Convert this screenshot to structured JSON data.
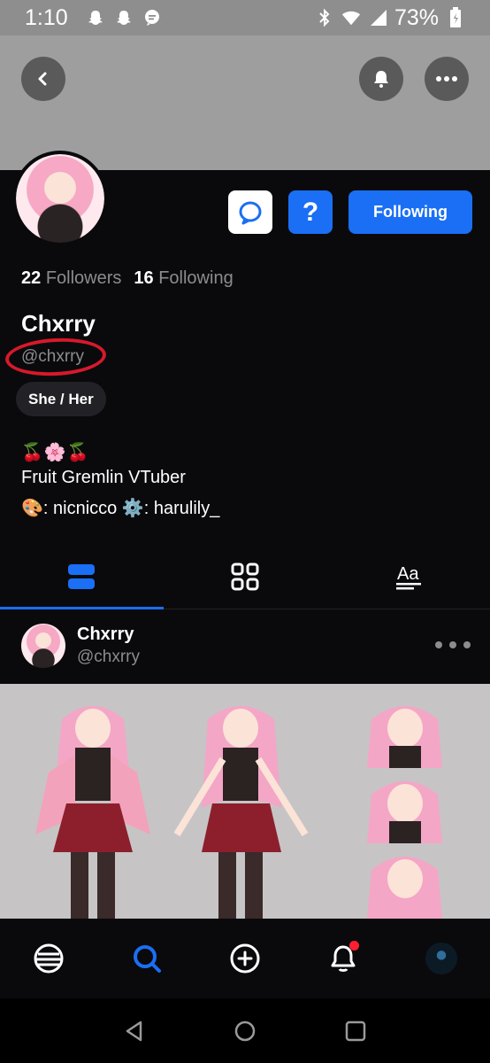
{
  "status_bar": {
    "time": "1:10",
    "battery": "73%"
  },
  "profile": {
    "follow_button": "Following",
    "ask_button": "?",
    "followers_count": "22",
    "followers_label": "Followers",
    "following_count": "16",
    "following_label": "Following",
    "display_name": "Chxrry",
    "handle": "@chxrry",
    "pronouns": "She / Her",
    "bio_emoji": "🍒🌸🍒",
    "bio_line1": "Fruit Gremlin VTuber",
    "bio_line2": "🎨: nicnicco ⚙️: harulily_"
  },
  "tabs": {
    "active_index": 0,
    "items": [
      "posts-icon",
      "grid-icon",
      "text-icon"
    ]
  },
  "post": {
    "author_name": "Chxrry",
    "author_handle": "@chxrry"
  },
  "bottom_nav": {
    "items": [
      "home-icon",
      "search-icon",
      "create-icon",
      "notifications-icon",
      "profile-avatar"
    ],
    "active_index": 1,
    "has_notification": true
  },
  "colors": {
    "accent": "#1a6ff5",
    "background": "#0a0a0d",
    "muted_text": "#8c8c8c",
    "annotation_red": "#d8192a"
  }
}
